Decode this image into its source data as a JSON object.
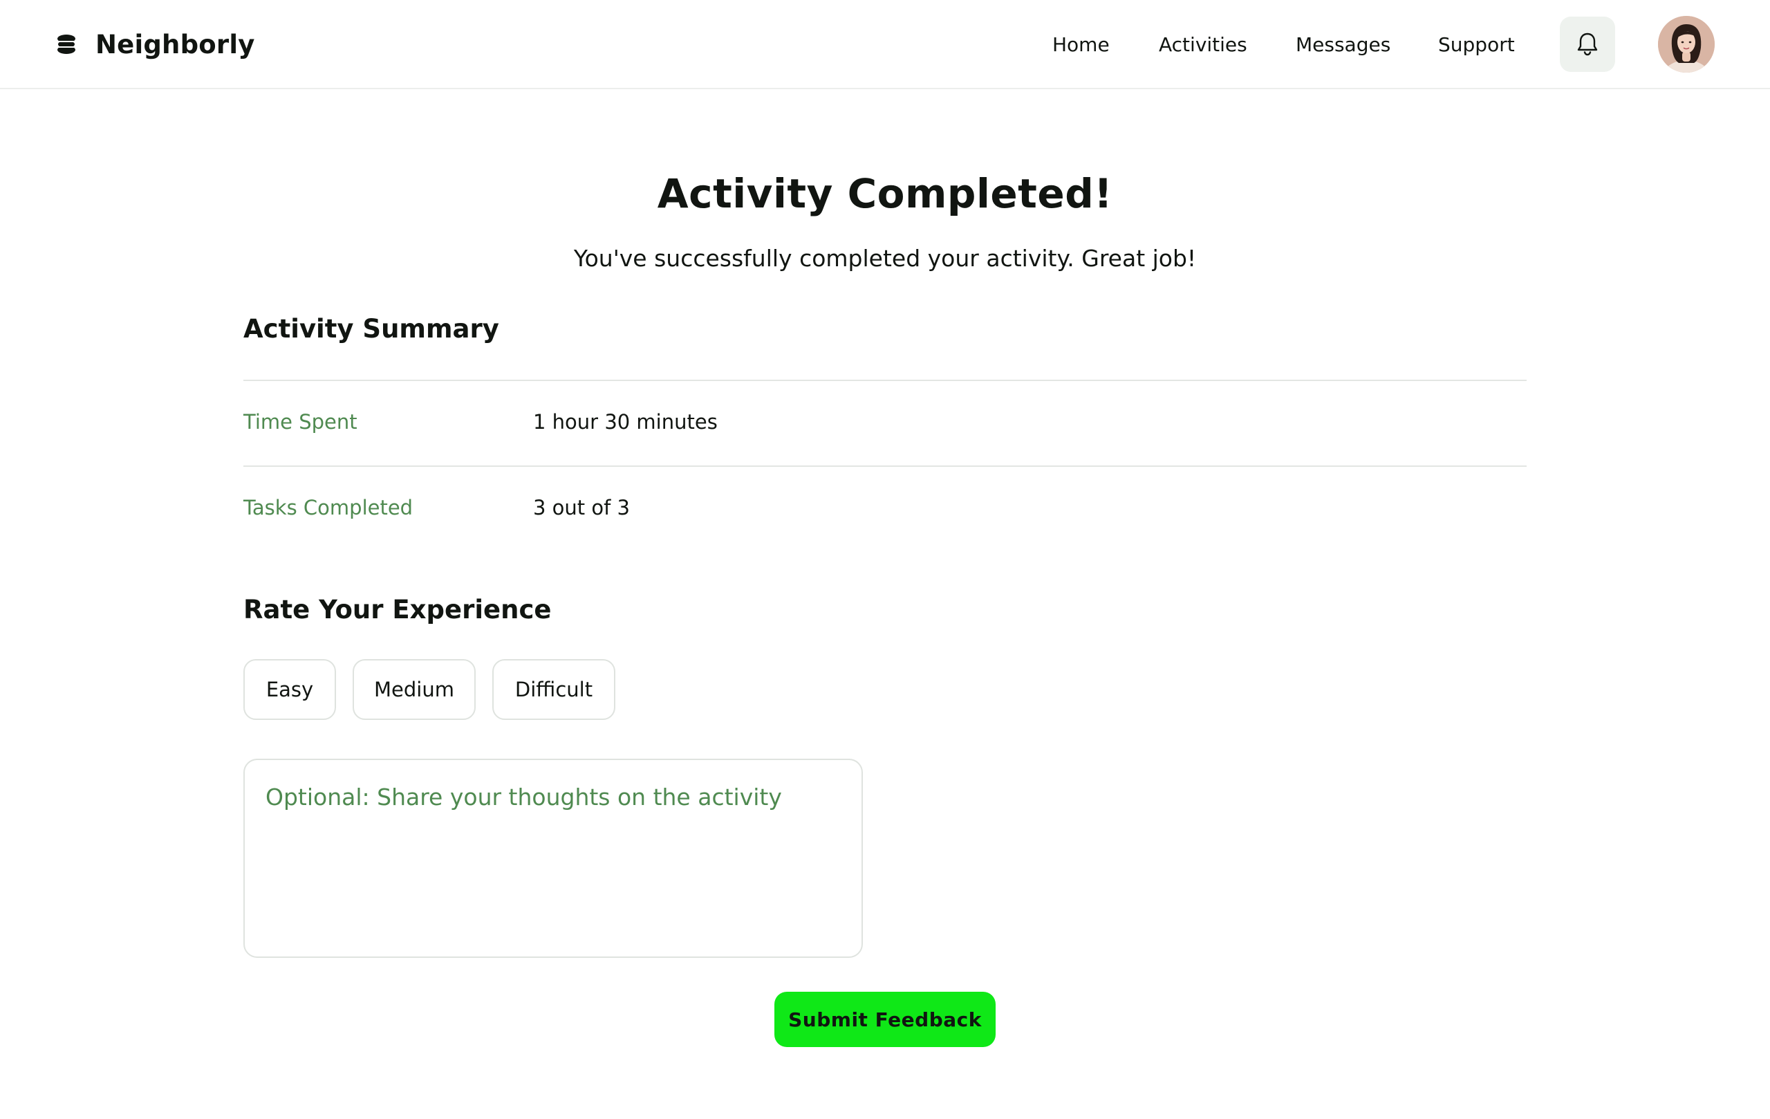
{
  "app": {
    "name": "Neighborly",
    "logo_icon": "stacked-layers-icon"
  },
  "nav": {
    "items": [
      {
        "label": "Home"
      },
      {
        "label": "Activities"
      },
      {
        "label": "Messages"
      },
      {
        "label": "Support"
      }
    ],
    "notification_icon": "bell-icon",
    "avatar_icon": "user-avatar"
  },
  "main": {
    "title": "Activity Completed!",
    "subtitle": "You've successfully completed your activity. Great job!",
    "summary": {
      "heading": "Activity Summary",
      "rows": [
        {
          "label": "Time Spent",
          "value": "1 hour 30 minutes"
        },
        {
          "label": "Tasks Completed",
          "value": "3 out of 3"
        }
      ]
    },
    "rating": {
      "heading": "Rate Your Experience",
      "options": [
        "Easy",
        "Medium",
        "Difficult"
      ]
    },
    "feedback": {
      "placeholder": "Optional: Share your thoughts on the activity",
      "value": ""
    },
    "submit_label": "Submit Feedback"
  },
  "colors": {
    "accent": "#0fe817",
    "muted_label": "#4f8a50",
    "text": "#111511",
    "border": "#dfe3df",
    "icon_button_bg": "#eef2ee"
  }
}
